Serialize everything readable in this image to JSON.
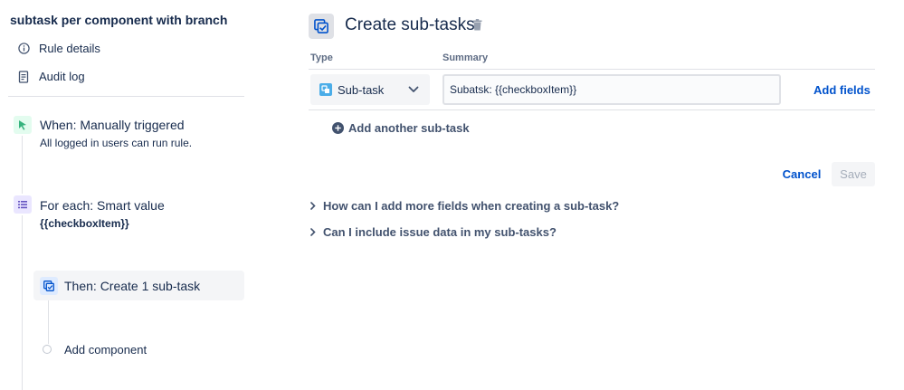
{
  "rule": {
    "title": "subtask per component with branch",
    "nav": [
      {
        "label": "Rule details",
        "icon": "info-icon"
      },
      {
        "label": "Audit log",
        "icon": "document-icon"
      }
    ]
  },
  "steps": {
    "trigger": {
      "title": "When: Manually triggered",
      "subtitle": "All logged in users can run rule.",
      "icon": "cursor-icon",
      "color": "#36b37e"
    },
    "branch": {
      "title": "For each: Smart value",
      "subtitle": "{{checkboxItem}}",
      "icon": "list-icon",
      "color": "#6554c0"
    },
    "action": {
      "title": "Then: Create 1 sub-task",
      "icon": "subtask-icon",
      "color": "#0052cc"
    },
    "add_component": "Add component"
  },
  "panel": {
    "title": "Create sub-tasks",
    "type_label": "Type",
    "summary_label": "Summary",
    "type_value": "Sub-task",
    "summary_value": "Subatsk: {{checkboxItem}}",
    "add_fields": "Add fields",
    "add_another": "Add another sub-task",
    "cancel": "Cancel",
    "save": "Save",
    "faqs": [
      "How can I add more fields when creating a sub-task?",
      "Can I include issue data in my sub-tasks?"
    ]
  },
  "colors": {
    "accent": "#0052cc",
    "subtask": "#4bade8"
  }
}
